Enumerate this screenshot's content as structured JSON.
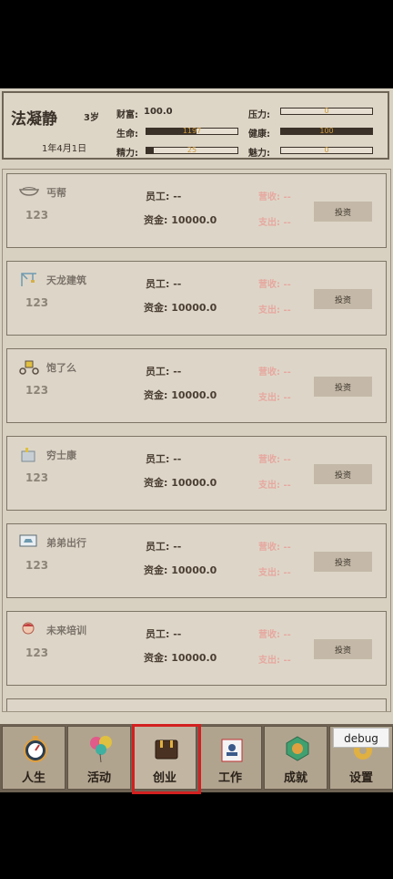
{
  "profile": {
    "name": "法凝静",
    "age": "3岁",
    "date": "1年4月1日",
    "wealth_label": "财富:",
    "wealth_value": "100.0",
    "life_label": "生命:",
    "life_text": "1197",
    "life_fill": 0.55,
    "energy_label": "精力:",
    "energy_text": "25",
    "energy_fill": 0.08,
    "pressure_label": "压力:",
    "pressure_text": "0",
    "pressure_fill": 0,
    "health_label": "健康:",
    "health_text": "100",
    "health_fill": 1,
    "charm_label": "魅力:",
    "charm_text": "0",
    "charm_fill": 0
  },
  "businesses": [
    {
      "name": "丐帮",
      "icon": "bowl-icon",
      "number": "123",
      "employees": "员工: --",
      "funds": "资金: 10000.0",
      "revenue": "营收: --",
      "expense": "支出: --",
      "invest": "投资"
    },
    {
      "name": "天龙建筑",
      "icon": "crane-icon",
      "number": "123",
      "employees": "员工: --",
      "funds": "资金: 10000.0",
      "revenue": "营收: --",
      "expense": "支出: --",
      "invest": "投资"
    },
    {
      "name": "饱了么",
      "icon": "scooter-icon",
      "number": "123",
      "employees": "员工: --",
      "funds": "资金: 10000.0",
      "revenue": "营收: --",
      "expense": "支出: --",
      "invest": "投资"
    },
    {
      "name": "穷士康",
      "icon": "factory-icon",
      "number": "123",
      "employees": "员工: --",
      "funds": "资金: 10000.0",
      "revenue": "营收: --",
      "expense": "支出: --",
      "invest": "投资"
    },
    {
      "name": "弟弟出行",
      "icon": "car-screen-icon",
      "number": "123",
      "employees": "员工: --",
      "funds": "资金: 10000.0",
      "revenue": "营收: --",
      "expense": "支出: --",
      "invest": "投资"
    },
    {
      "name": "未来培训",
      "icon": "student-icon",
      "number": "123",
      "employees": "员工: --",
      "funds": "资金: 10000.0",
      "revenue": "营收: --",
      "expense": "支出: --",
      "invest": "投资"
    }
  ],
  "nav": {
    "tabs": [
      {
        "label": "人生",
        "icon": "stopwatch-icon"
      },
      {
        "label": "活动",
        "icon": "balloons-icon"
      },
      {
        "label": "创业",
        "icon": "briefcase-icon"
      },
      {
        "label": "工作",
        "icon": "badge-card-icon"
      },
      {
        "label": "成就",
        "icon": "medal-icon"
      },
      {
        "label": "设置",
        "icon": "gear-icon"
      }
    ],
    "active_index": 2,
    "debug_label": "debug"
  }
}
